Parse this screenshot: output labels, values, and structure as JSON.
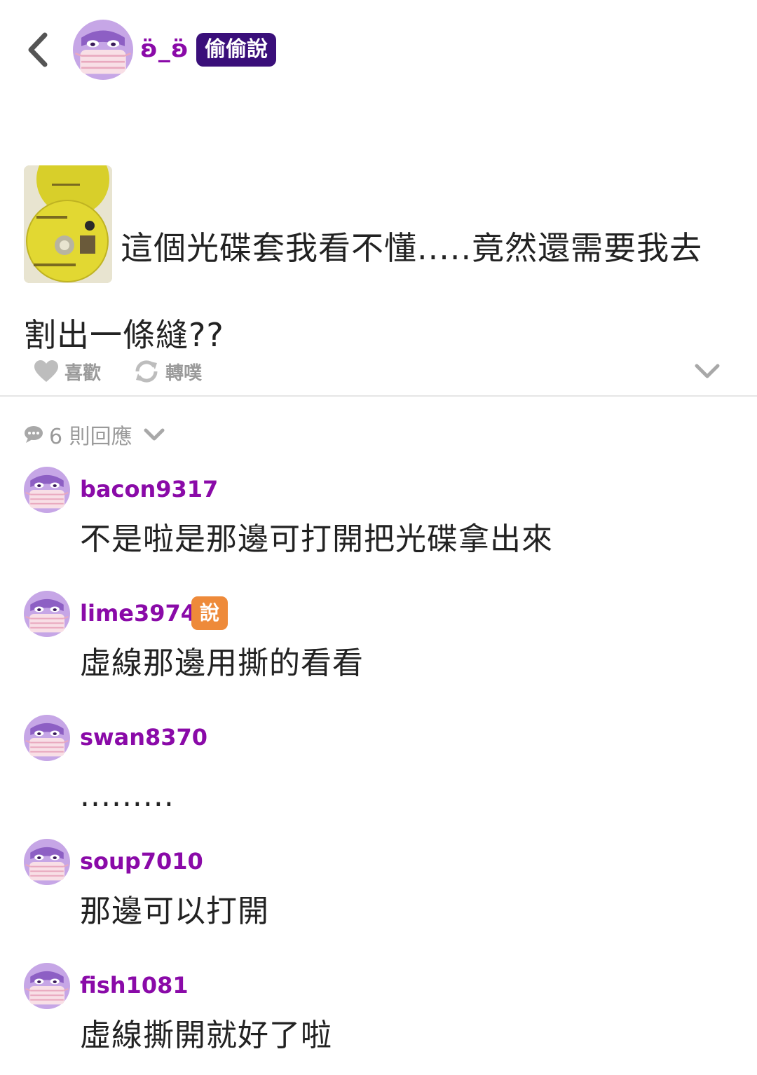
{
  "header": {
    "author_name": "ʚ̈_ʚ̈",
    "secret_badge": "偷偷說"
  },
  "post": {
    "text": "這個光碟套我看不懂.....竟然還需要我去割出一條縫??"
  },
  "actions": {
    "like_label": "喜歡",
    "replurk_label": "轉噗"
  },
  "responses": {
    "count_label": "6 則回應"
  },
  "comments": [
    {
      "user": "bacon9317",
      "text": "不是啦是那邊可打開把光碟拿出來",
      "badge": ""
    },
    {
      "user": "lime3974",
      "text": "虛線那邊用撕的看看",
      "badge": "說"
    },
    {
      "user": "swan8370",
      "text": ".........",
      "badge": ""
    },
    {
      "user": "soup7010",
      "text": "那邊可以打開",
      "badge": ""
    },
    {
      "user": "fish1081",
      "text": "虛線撕開就好了啦",
      "badge": ""
    }
  ],
  "colors": {
    "username": "#8a0aa8",
    "secret_badge_bg": "#3a0f7a",
    "speaker_badge_bg": "#ee8a3a",
    "muted": "#9a9a9a"
  },
  "icons": {
    "back": "chevron-left-icon",
    "like": "heart-icon",
    "replurk": "replurk-icon",
    "expand": "chevron-down-icon",
    "responses": "speech-bubble-icon",
    "avatar": "masked-ghost-avatar"
  }
}
